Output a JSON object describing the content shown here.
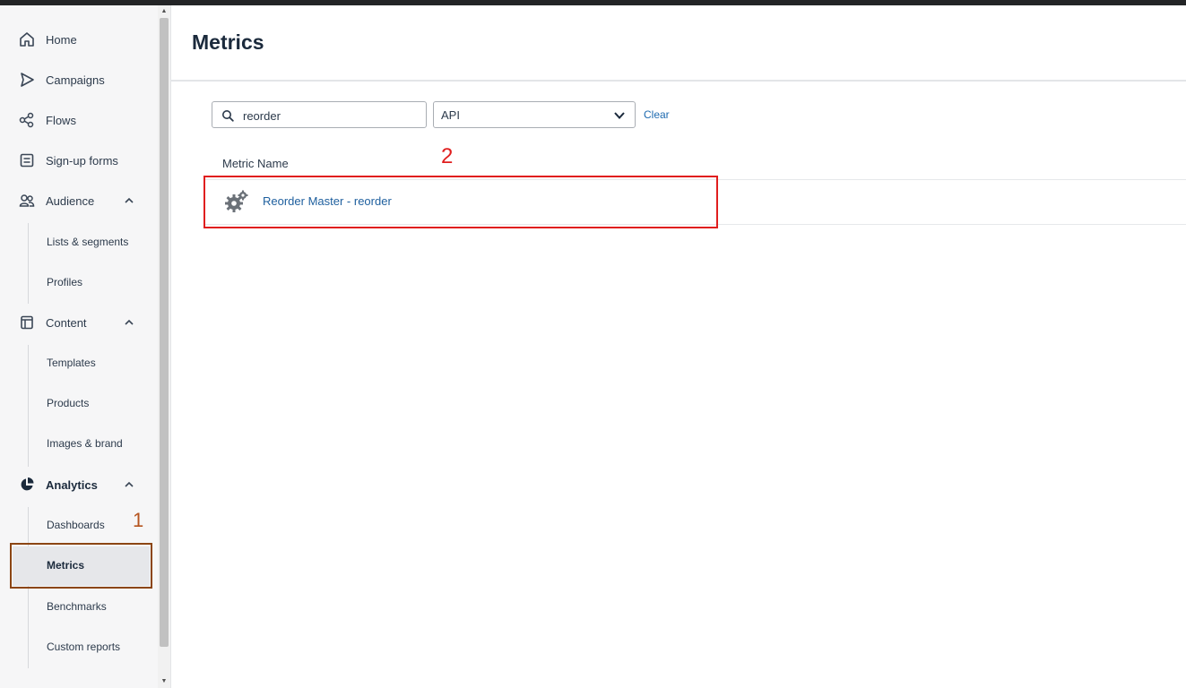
{
  "sidebar": {
    "items": [
      {
        "label": "Home",
        "icon": "home-icon"
      },
      {
        "label": "Campaigns",
        "icon": "send-icon"
      },
      {
        "label": "Flows",
        "icon": "flows-icon"
      },
      {
        "label": "Sign-up forms",
        "icon": "form-icon"
      },
      {
        "label": "Audience",
        "icon": "users-icon",
        "expanded": true,
        "children": [
          {
            "label": "Lists & segments"
          },
          {
            "label": "Profiles"
          }
        ]
      },
      {
        "label": "Content",
        "icon": "content-icon",
        "expanded": true,
        "children": [
          {
            "label": "Templates"
          },
          {
            "label": "Products"
          },
          {
            "label": "Images & brand"
          }
        ]
      },
      {
        "label": "Analytics",
        "icon": "pie-chart-icon",
        "expanded": true,
        "children": [
          {
            "label": "Dashboards"
          },
          {
            "label": "Metrics",
            "active": true
          },
          {
            "label": "Benchmarks"
          },
          {
            "label": "Custom reports"
          }
        ]
      }
    ]
  },
  "page": {
    "title": "Metrics"
  },
  "filters": {
    "search_value": "reorder",
    "type_select_value": "API",
    "clear_label": "Clear"
  },
  "table": {
    "column_header": "Metric Name",
    "rows": [
      {
        "name": "Reorder Master - reorder",
        "icon": "gears-icon"
      }
    ]
  },
  "annotations": {
    "step1": "1",
    "step2": "2"
  },
  "colors": {
    "link": "#1e5f9e",
    "annotation_red": "#e01e1e",
    "annotation_brown": "#8b4513",
    "sidebar_bg": "#f6f6f7"
  }
}
